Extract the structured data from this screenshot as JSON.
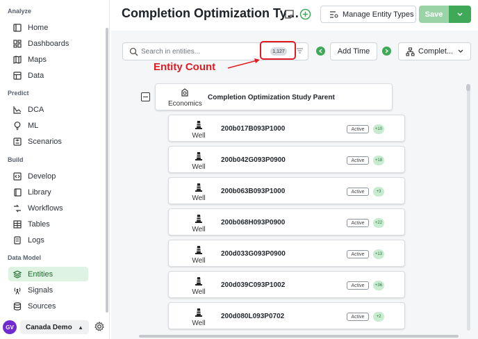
{
  "sidebar": {
    "sections": [
      {
        "title": "Analyze",
        "items": [
          {
            "label": "Home",
            "icon": "home-icon"
          },
          {
            "label": "Dashboards",
            "icon": "dashboards-icon"
          },
          {
            "label": "Maps",
            "icon": "map-icon"
          },
          {
            "label": "Data",
            "icon": "data-icon"
          }
        ]
      },
      {
        "title": "Predict",
        "items": [
          {
            "label": "DCA",
            "icon": "dca-chart-icon"
          },
          {
            "label": "ML",
            "icon": "lightbulb-icon"
          },
          {
            "label": "Scenarios",
            "icon": "scenarios-icon"
          }
        ]
      },
      {
        "title": "Build",
        "items": [
          {
            "label": "Develop",
            "icon": "code-icon"
          },
          {
            "label": "Library",
            "icon": "library-icon"
          },
          {
            "label": "Workflows",
            "icon": "workflows-icon"
          },
          {
            "label": "Tables",
            "icon": "table-icon"
          },
          {
            "label": "Logs",
            "icon": "logs-icon"
          }
        ]
      },
      {
        "title": "Data Model",
        "items": [
          {
            "label": "Entities",
            "icon": "entities-icon",
            "active": true
          },
          {
            "label": "Signals",
            "icon": "signals-icon"
          },
          {
            "label": "Sources",
            "icon": "database-icon"
          }
        ]
      }
    ],
    "user_initials": "GV",
    "tenant": "Canada Demo"
  },
  "header": {
    "title": "Completion Optimization Ty…",
    "manage_label": "Manage Entity Types",
    "save_label": "Save"
  },
  "toolbar": {
    "search_placeholder": "Search in entities...",
    "entity_count": "1,127",
    "add_time_label": "Add Time",
    "select_label": "Complet..."
  },
  "annotation": {
    "label": "Entity Count"
  },
  "tree": {
    "parent": {
      "type": "Economics",
      "name": "Completion Optimization Study Parent"
    },
    "children": [
      {
        "type": "Well",
        "name": "200b017B093P1000",
        "status": "Active",
        "badge": "+10"
      },
      {
        "type": "Well",
        "name": "200b042G093P0900",
        "status": "Active",
        "badge": "+18"
      },
      {
        "type": "Well",
        "name": "200b063B093P1000",
        "status": "Active",
        "badge": "+3"
      },
      {
        "type": "Well",
        "name": "200b068H093P0900",
        "status": "Active",
        "badge": "+22"
      },
      {
        "type": "Well",
        "name": "200d033G093P0900",
        "status": "Active",
        "badge": "+13"
      },
      {
        "type": "Well",
        "name": "200d039C093P1002",
        "status": "Active",
        "badge": "+36"
      },
      {
        "type": "Well",
        "name": "200d080L093P0702",
        "status": "Active",
        "badge": "+2"
      }
    ]
  },
  "colors": {
    "accent": "#3fa958",
    "highlight": "#e11b22",
    "active_bg": "#dff3e2"
  }
}
